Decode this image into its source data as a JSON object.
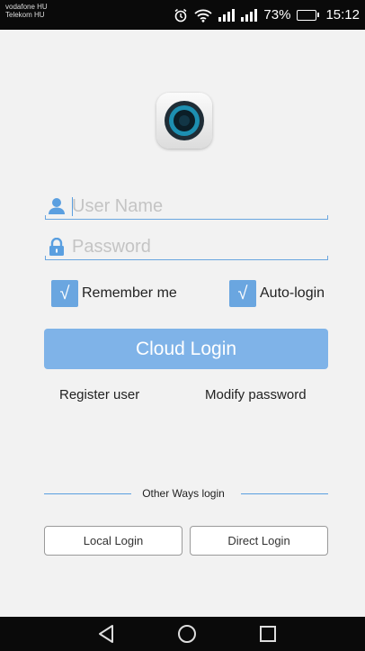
{
  "status_bar": {
    "carrier_1": "vodafone HU",
    "carrier_2": "Telekom HU",
    "battery_percent": "73%",
    "battery_level": 0.73,
    "time": "15:12",
    "icons": [
      "alarm-icon",
      "wifi-icon",
      "signal-icon",
      "signal-icon",
      "battery-icon"
    ]
  },
  "login_form": {
    "username_placeholder": "User Name",
    "username_value": "",
    "password_placeholder": "Password",
    "password_value": "",
    "remember_me_label": "Remember me",
    "remember_me_checked": true,
    "auto_login_label": "Auto-login",
    "auto_login_checked": true,
    "cloud_login_label": "Cloud Login",
    "register_label": "Register user",
    "modify_password_label": "Modify password"
  },
  "other_ways": {
    "heading": "Other Ways login",
    "local_login_label": "Local Login",
    "direct_login_label": "Direct Login"
  },
  "nav_bar": {
    "icons": [
      "back-icon",
      "home-icon",
      "recents-icon"
    ]
  },
  "colors": {
    "accent": "#6aa6e0",
    "cloud_button": "#7fb3e8",
    "background": "#f2f2f2"
  }
}
